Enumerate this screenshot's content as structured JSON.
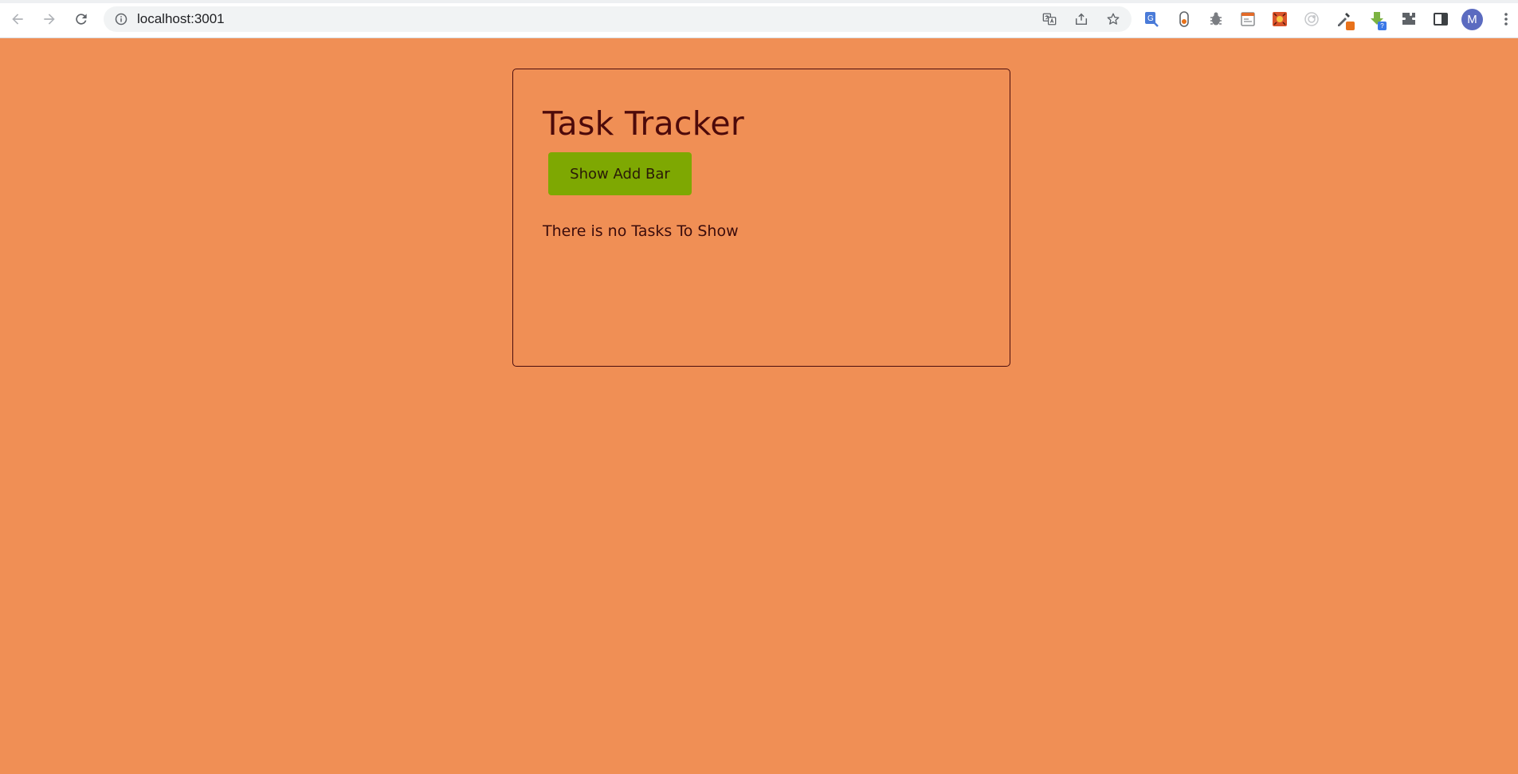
{
  "browser": {
    "url": "localhost:3001",
    "profile_initial": "M",
    "extensions": [
      "google-translate-icon",
      "share-icon",
      "bookmark-star-icon",
      "google-dictionary-icon",
      "toggle-icon",
      "bug-icon",
      "reader-icon",
      "pattern-icon",
      "target-icon",
      "color-picker-icon",
      "download-icon",
      "puzzle-icon",
      "side-panel-icon"
    ],
    "badges": {
      "download": "?"
    }
  },
  "app": {
    "title": "Task Tracker",
    "show_add_label": "Show Add Bar",
    "empty_message": "There is no Tasks To Show"
  },
  "colors": {
    "page_background": "#f08f55",
    "button_background": "#7ea802",
    "title_color": "#4d0a0a",
    "card_border": "#4a0d0d"
  }
}
